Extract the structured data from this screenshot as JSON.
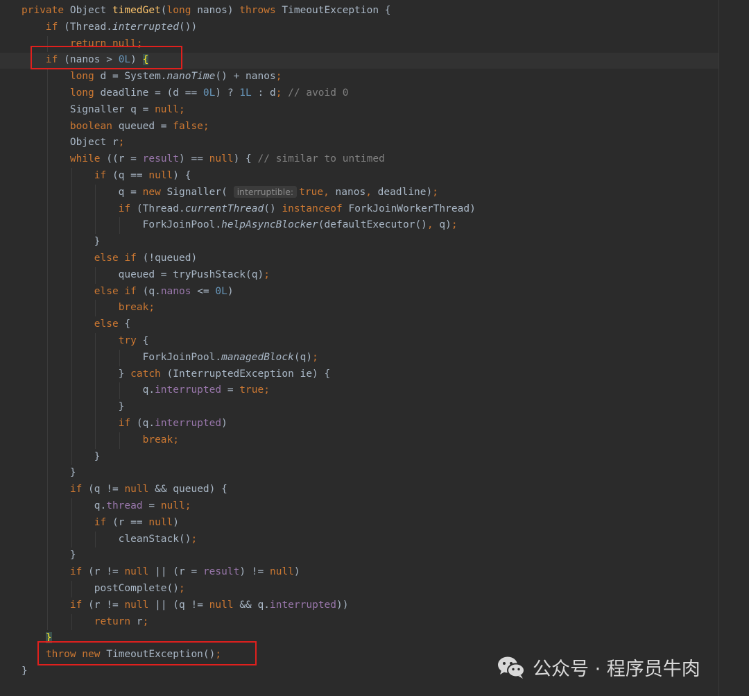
{
  "editor": {
    "lines": [
      [
        {
          "t": "private ",
          "c": "kw"
        },
        {
          "t": "Object "
        },
        {
          "t": "timedGet",
          "c": "fn"
        },
        {
          "t": "("
        },
        {
          "t": "long ",
          "c": "kw"
        },
        {
          "t": "nanos) "
        },
        {
          "t": "throws ",
          "c": "kw"
        },
        {
          "t": "TimeoutException {"
        }
      ],
      [
        {
          "t": "    "
        },
        {
          "t": "if ",
          "c": "kw"
        },
        {
          "t": "(Thread."
        },
        {
          "t": "interrupted",
          "c": "it"
        },
        {
          "t": "())"
        }
      ],
      [
        {
          "t": "        "
        },
        {
          "t": "return null",
          "c": "kw"
        },
        {
          "t": ";",
          "c": "kw"
        }
      ],
      [
        {
          "t": "    "
        },
        {
          "t": "if ",
          "c": "kw"
        },
        {
          "t": "(nanos > "
        },
        {
          "t": "0L",
          "c": "num"
        },
        {
          "t": ") "
        },
        {
          "t": "{",
          "c": "brace-match"
        }
      ],
      [
        {
          "t": "        "
        },
        {
          "t": "long ",
          "c": "kw"
        },
        {
          "t": "d = System."
        },
        {
          "t": "nanoTime",
          "c": "it"
        },
        {
          "t": "() + nanos"
        },
        {
          "t": ";",
          "c": "kw"
        }
      ],
      [
        {
          "t": "        "
        },
        {
          "t": "long ",
          "c": "kw"
        },
        {
          "t": "deadline = (d == "
        },
        {
          "t": "0L",
          "c": "num"
        },
        {
          "t": ") ? "
        },
        {
          "t": "1L",
          "c": "num"
        },
        {
          "t": " : d"
        },
        {
          "t": "; ",
          "c": "kw"
        },
        {
          "t": "// avoid 0",
          "c": "cm"
        }
      ],
      [
        {
          "t": "        Signaller q = "
        },
        {
          "t": "null;",
          "c": "kw"
        }
      ],
      [
        {
          "t": "        "
        },
        {
          "t": "boolean ",
          "c": "kw"
        },
        {
          "t": "queued = "
        },
        {
          "t": "false;",
          "c": "kw"
        }
      ],
      [
        {
          "t": "        Object r"
        },
        {
          "t": ";",
          "c": "kw"
        }
      ],
      [
        {
          "t": "        "
        },
        {
          "t": "while ",
          "c": "kw"
        },
        {
          "t": "((r = "
        },
        {
          "t": "result",
          "c": "fld"
        },
        {
          "t": ") == "
        },
        {
          "t": "null",
          "c": "kw"
        },
        {
          "t": ") { "
        },
        {
          "t": "// similar to untimed",
          "c": "cm"
        }
      ],
      [
        {
          "t": "            "
        },
        {
          "t": "if ",
          "c": "kw"
        },
        {
          "t": "(q == "
        },
        {
          "t": "null",
          "c": "kw"
        },
        {
          "t": ") {"
        }
      ],
      [
        {
          "t": "                q = "
        },
        {
          "t": "new ",
          "c": "kw"
        },
        {
          "t": "Signaller( "
        },
        {
          "t": "interruptible:",
          "c": "hint"
        },
        {
          "t": "true, ",
          "c": "kw"
        },
        {
          "t": "nanos"
        },
        {
          "t": ", ",
          "c": "kw"
        },
        {
          "t": "deadline)"
        },
        {
          "t": ";",
          "c": "kw"
        }
      ],
      [
        {
          "t": "                "
        },
        {
          "t": "if ",
          "c": "kw"
        },
        {
          "t": "(Thread."
        },
        {
          "t": "currentThread",
          "c": "it"
        },
        {
          "t": "() "
        },
        {
          "t": "instanceof ",
          "c": "kw"
        },
        {
          "t": "ForkJoinWorkerThread)"
        }
      ],
      [
        {
          "t": "                    ForkJoinPool."
        },
        {
          "t": "helpAsyncBlocker",
          "c": "it"
        },
        {
          "t": "(defaultExecutor()"
        },
        {
          "t": ", ",
          "c": "kw"
        },
        {
          "t": "q)"
        },
        {
          "t": ";",
          "c": "kw"
        }
      ],
      [
        {
          "t": "            }"
        }
      ],
      [
        {
          "t": "            "
        },
        {
          "t": "else if ",
          "c": "kw"
        },
        {
          "t": "(!queued)"
        }
      ],
      [
        {
          "t": "                queued = tryPushStack(q)"
        },
        {
          "t": ";",
          "c": "kw"
        }
      ],
      [
        {
          "t": "            "
        },
        {
          "t": "else if ",
          "c": "kw"
        },
        {
          "t": "(q."
        },
        {
          "t": "nanos",
          "c": "fld"
        },
        {
          "t": " <= "
        },
        {
          "t": "0L",
          "c": "num"
        },
        {
          "t": ")"
        }
      ],
      [
        {
          "t": "                "
        },
        {
          "t": "break;",
          "c": "kw"
        }
      ],
      [
        {
          "t": "            "
        },
        {
          "t": "else ",
          "c": "kw"
        },
        {
          "t": "{"
        }
      ],
      [
        {
          "t": "                "
        },
        {
          "t": "try ",
          "c": "kw"
        },
        {
          "t": "{"
        }
      ],
      [
        {
          "t": "                    ForkJoinPool."
        },
        {
          "t": "managedBlock",
          "c": "it"
        },
        {
          "t": "(q)"
        },
        {
          "t": ";",
          "c": "kw"
        }
      ],
      [
        {
          "t": "                } "
        },
        {
          "t": "catch ",
          "c": "kw"
        },
        {
          "t": "(InterruptedException ie) {"
        }
      ],
      [
        {
          "t": "                    q."
        },
        {
          "t": "interrupted",
          "c": "fld"
        },
        {
          "t": " = "
        },
        {
          "t": "true;",
          "c": "kw"
        }
      ],
      [
        {
          "t": "                }"
        }
      ],
      [
        {
          "t": "                "
        },
        {
          "t": "if ",
          "c": "kw"
        },
        {
          "t": "(q."
        },
        {
          "t": "interrupted",
          "c": "fld"
        },
        {
          "t": ")"
        }
      ],
      [
        {
          "t": "                    "
        },
        {
          "t": "break;",
          "c": "kw"
        }
      ],
      [
        {
          "t": "            }"
        }
      ],
      [
        {
          "t": "        }"
        }
      ],
      [
        {
          "t": "        "
        },
        {
          "t": "if ",
          "c": "kw"
        },
        {
          "t": "(q != "
        },
        {
          "t": "null ",
          "c": "kw"
        },
        {
          "t": "&& queued) {"
        }
      ],
      [
        {
          "t": "            q."
        },
        {
          "t": "thread",
          "c": "fld"
        },
        {
          "t": " = "
        },
        {
          "t": "null;",
          "c": "kw"
        }
      ],
      [
        {
          "t": "            "
        },
        {
          "t": "if ",
          "c": "kw"
        },
        {
          "t": "(r == "
        },
        {
          "t": "null",
          "c": "kw"
        },
        {
          "t": ")"
        }
      ],
      [
        {
          "t": "                cleanStack()"
        },
        {
          "t": ";",
          "c": "kw"
        }
      ],
      [
        {
          "t": "        }"
        }
      ],
      [
        {
          "t": "        "
        },
        {
          "t": "if ",
          "c": "kw"
        },
        {
          "t": "(r != "
        },
        {
          "t": "null ",
          "c": "kw"
        },
        {
          "t": "|| (r = "
        },
        {
          "t": "result",
          "c": "fld"
        },
        {
          "t": ") != "
        },
        {
          "t": "null",
          "c": "kw"
        },
        {
          "t": ")"
        }
      ],
      [
        {
          "t": "            postComplete()"
        },
        {
          "t": ";",
          "c": "kw"
        }
      ],
      [
        {
          "t": "        "
        },
        {
          "t": "if ",
          "c": "kw"
        },
        {
          "t": "(r != "
        },
        {
          "t": "null ",
          "c": "kw"
        },
        {
          "t": "|| (q != "
        },
        {
          "t": "null ",
          "c": "kw"
        },
        {
          "t": "&& q."
        },
        {
          "t": "interrupted",
          "c": "fld"
        },
        {
          "t": "))"
        }
      ],
      [
        {
          "t": "            "
        },
        {
          "t": "return ",
          "c": "kw"
        },
        {
          "t": "r"
        },
        {
          "t": ";",
          "c": "kw"
        }
      ],
      [
        {
          "t": "    "
        },
        {
          "t": "}",
          "c": "brace-match"
        }
      ],
      [
        {
          "t": "    "
        },
        {
          "t": "throw new ",
          "c": "kw"
        },
        {
          "t": "TimeoutException()"
        },
        {
          "t": ";",
          "c": "kw"
        }
      ],
      [
        {
          "t": "}"
        }
      ]
    ]
  },
  "watermark": {
    "text": "公众号 · 程序员牛肉",
    "icon": "wechat-icon"
  },
  "colors": {
    "background": "#2b2b2b",
    "keyword": "#cc7832",
    "method": "#ffc66d",
    "number": "#6897bb",
    "field": "#9876aa",
    "comment": "#808080",
    "plain": "#a9b7c6",
    "annotation_box": "#e0201d"
  }
}
